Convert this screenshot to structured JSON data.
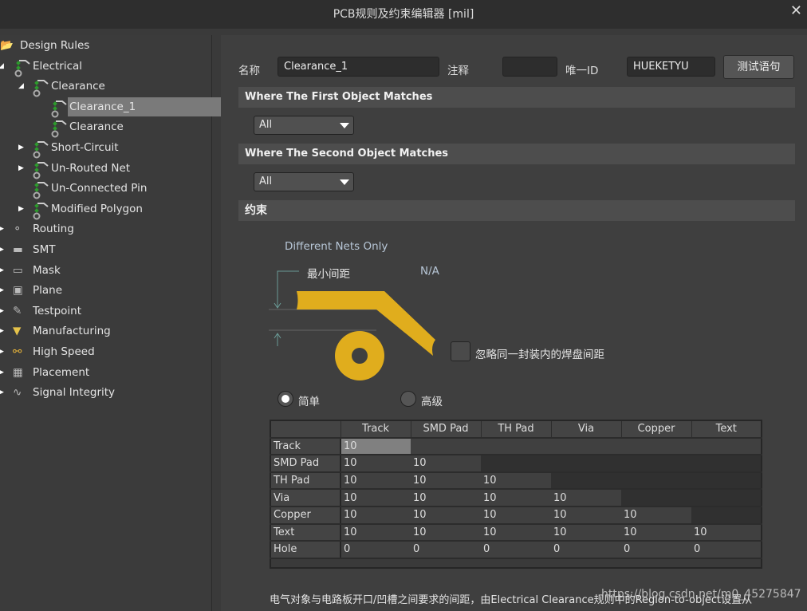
{
  "window": {
    "title": "PCB规则及约束编辑器 [mil]",
    "close": "✕"
  },
  "tree": [
    {
      "label": "Design Rules",
      "level": 0,
      "icon": "folder-rules-icon",
      "toggle": ""
    },
    {
      "label": "Electrical",
      "level": 1,
      "icon": "rule-icon",
      "toggle": "expanded"
    },
    {
      "label": "Clearance",
      "level": 2,
      "icon": "rule-icon",
      "toggle": "expanded"
    },
    {
      "label": "Clearance_1",
      "level": 3,
      "icon": "rule-icon",
      "toggle": "",
      "selected": true
    },
    {
      "label": "Clearance",
      "level": 3,
      "icon": "rule-icon",
      "toggle": ""
    },
    {
      "label": "Short-Circuit",
      "level": 2,
      "icon": "rule-icon",
      "toggle": "collapsed"
    },
    {
      "label": "Un-Routed Net",
      "level": 2,
      "icon": "rule-icon",
      "toggle": "collapsed"
    },
    {
      "label": "Un-Connected Pin",
      "level": 2,
      "icon": "rule-icon",
      "toggle": ""
    },
    {
      "label": "Modified Polygon",
      "level": 2,
      "icon": "rule-icon",
      "toggle": "collapsed"
    },
    {
      "label": "Routing",
      "level": 1,
      "icon": "routing-icon",
      "toggle": "collapsed"
    },
    {
      "label": "SMT",
      "level": 1,
      "icon": "smt-icon",
      "toggle": "collapsed"
    },
    {
      "label": "Mask",
      "level": 1,
      "icon": "mask-icon",
      "toggle": "collapsed"
    },
    {
      "label": "Plane",
      "level": 1,
      "icon": "plane-icon",
      "toggle": "collapsed"
    },
    {
      "label": "Testpoint",
      "level": 1,
      "icon": "testpoint-icon",
      "toggle": "collapsed"
    },
    {
      "label": "Manufacturing",
      "level": 1,
      "icon": "manufacturing-icon",
      "toggle": "collapsed"
    },
    {
      "label": "High Speed",
      "level": 1,
      "icon": "high-speed-icon",
      "toggle": "collapsed"
    },
    {
      "label": "Placement",
      "level": 1,
      "icon": "placement-icon",
      "toggle": "collapsed"
    },
    {
      "label": "Signal Integrity",
      "level": 1,
      "icon": "signal-integrity-icon",
      "toggle": "collapsed"
    }
  ],
  "form": {
    "name_label": "名称",
    "name_value": "Clearance_1",
    "comment_label": "注释",
    "comment_value": "",
    "id_label": "唯一ID",
    "id_value": "HUEKETYU",
    "test_button": "测试语句"
  },
  "first": {
    "title": "Where The First Object Matches",
    "value": "All"
  },
  "second": {
    "title": "Where The Second Object Matches",
    "value": "All"
  },
  "constraints": {
    "title": "约束",
    "net_scope": "Different Nets Only",
    "min_label": "最小间距",
    "min_value": "N/A",
    "ignore_label": "忽略同一封装内的焊盘间距",
    "ignore_checked": false,
    "mode_simple": "简单",
    "mode_advanced": "高级",
    "mode_selected": "simple",
    "track_color": "#e0ad1d"
  },
  "matrix": {
    "columns": [
      "Track",
      "SMD Pad",
      "TH Pad",
      "Via",
      "Copper",
      "Text"
    ],
    "rows": [
      {
        "label": "Track",
        "values": [
          "10",
          "",
          "",
          "",
          "",
          ""
        ]
      },
      {
        "label": "SMD Pad",
        "values": [
          "10",
          "10",
          "",
          "",
          "",
          ""
        ]
      },
      {
        "label": "TH Pad",
        "values": [
          "10",
          "10",
          "10",
          "",
          "",
          ""
        ]
      },
      {
        "label": "Via",
        "values": [
          "10",
          "10",
          "10",
          "10",
          "",
          ""
        ]
      },
      {
        "label": "Copper",
        "values": [
          "10",
          "10",
          "10",
          "10",
          "10",
          ""
        ]
      },
      {
        "label": "Text",
        "values": [
          "10",
          "10",
          "10",
          "10",
          "10",
          "10"
        ]
      },
      {
        "label": "Hole",
        "values": [
          "0",
          "0",
          "0",
          "0",
          "0",
          "0"
        ]
      }
    ]
  },
  "footer": {
    "note": "电气对象与电路板开口/凹槽之间要求的间距，由Electrical Clearance规则中的Region-to-object设置从",
    "watermark": "https://blog.csdn.net/m0_45275847"
  }
}
